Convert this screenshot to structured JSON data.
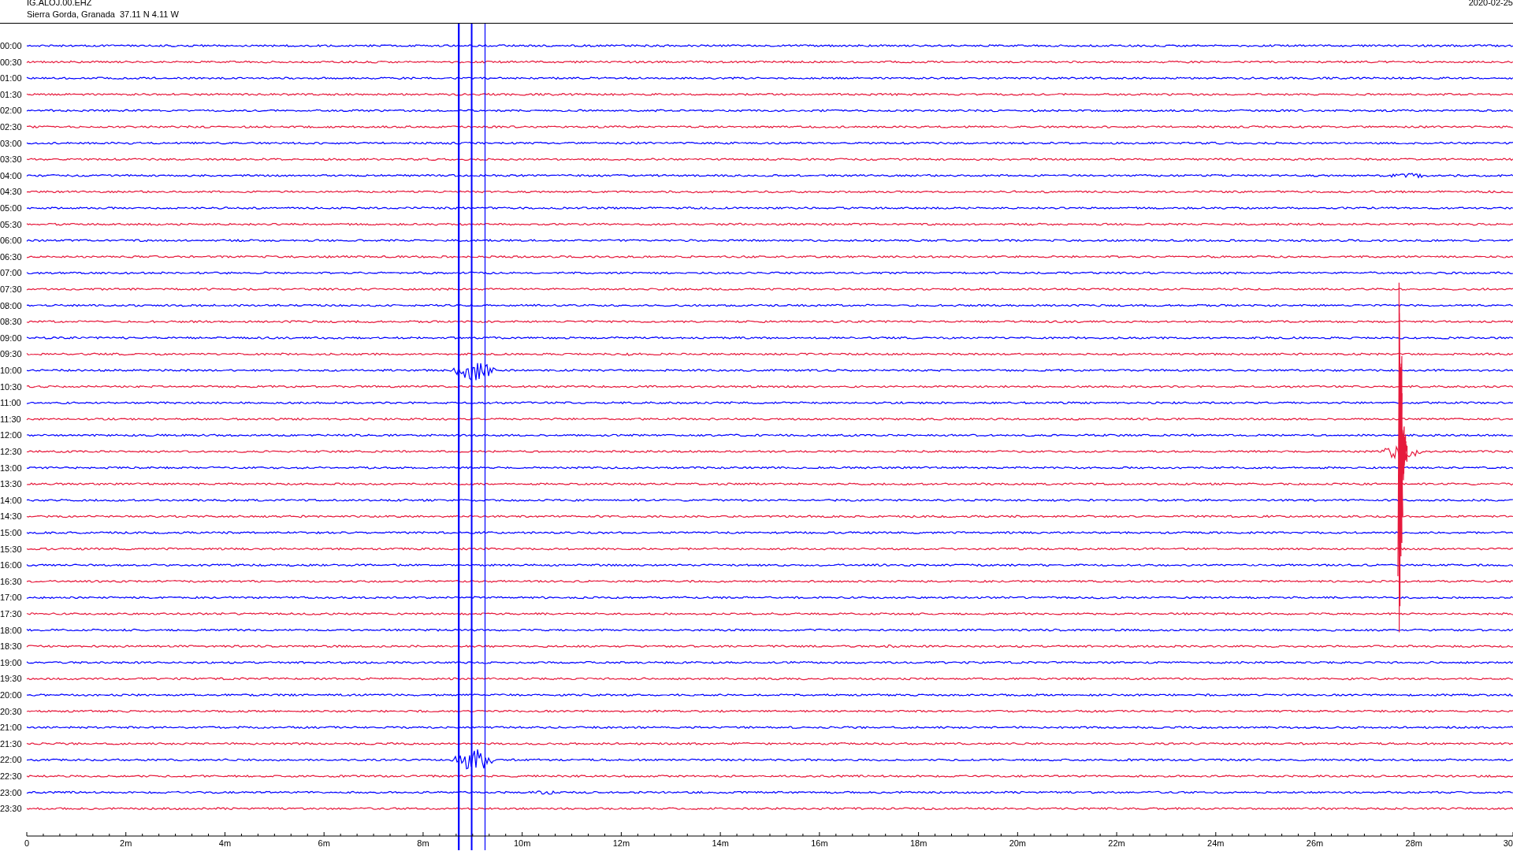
{
  "header": {
    "channel": "IG.ALOJ.00.EHZ",
    "location": "Sierra Gorda, Granada  37.11 N 4.11 W",
    "date": "2020-02-25"
  },
  "rows": [
    {
      "time": "00:00",
      "color": "#0000ff"
    },
    {
      "time": "00:30",
      "color": "#e6193c"
    },
    {
      "time": "01:00",
      "color": "#0000ff"
    },
    {
      "time": "01:30",
      "color": "#e6193c"
    },
    {
      "time": "02:00",
      "color": "#0000ff"
    },
    {
      "time": "02:30",
      "color": "#e6193c"
    },
    {
      "time": "03:00",
      "color": "#0000ff"
    },
    {
      "time": "03:30",
      "color": "#e6193c"
    },
    {
      "time": "04:00",
      "color": "#0000ff"
    },
    {
      "time": "04:30",
      "color": "#e6193c"
    },
    {
      "time": "05:00",
      "color": "#0000ff"
    },
    {
      "time": "05:30",
      "color": "#e6193c"
    },
    {
      "time": "06:00",
      "color": "#0000ff"
    },
    {
      "time": "06:30",
      "color": "#e6193c"
    },
    {
      "time": "07:00",
      "color": "#0000ff"
    },
    {
      "time": "07:30",
      "color": "#e6193c"
    },
    {
      "time": "08:00",
      "color": "#0000ff"
    },
    {
      "time": "08:30",
      "color": "#e6193c"
    },
    {
      "time": "09:00",
      "color": "#0000ff"
    },
    {
      "time": "09:30",
      "color": "#e6193c"
    },
    {
      "time": "10:00",
      "color": "#0000ff"
    },
    {
      "time": "10:30",
      "color": "#e6193c"
    },
    {
      "time": "11:00",
      "color": "#0000ff"
    },
    {
      "time": "11:30",
      "color": "#e6193c"
    },
    {
      "time": "12:00",
      "color": "#0000ff"
    },
    {
      "time": "12:30",
      "color": "#e6193c"
    },
    {
      "time": "13:00",
      "color": "#0000ff"
    },
    {
      "time": "13:30",
      "color": "#e6193c"
    },
    {
      "time": "14:00",
      "color": "#0000ff"
    },
    {
      "time": "14:30",
      "color": "#e6193c"
    },
    {
      "time": "15:00",
      "color": "#0000ff"
    },
    {
      "time": "15:30",
      "color": "#e6193c"
    },
    {
      "time": "16:00",
      "color": "#0000ff"
    },
    {
      "time": "16:30",
      "color": "#e6193c"
    },
    {
      "time": "17:00",
      "color": "#0000ff"
    },
    {
      "time": "17:30",
      "color": "#e6193c"
    },
    {
      "time": "18:00",
      "color": "#0000ff"
    },
    {
      "time": "18:30",
      "color": "#e6193c"
    },
    {
      "time": "19:00",
      "color": "#0000ff"
    },
    {
      "time": "19:30",
      "color": "#e6193c"
    },
    {
      "time": "20:00",
      "color": "#0000ff"
    },
    {
      "time": "20:30",
      "color": "#e6193c"
    },
    {
      "time": "21:00",
      "color": "#0000ff"
    },
    {
      "time": "21:30",
      "color": "#e6193c"
    },
    {
      "time": "22:00",
      "color": "#0000ff"
    },
    {
      "time": "22:30",
      "color": "#e6193c"
    },
    {
      "time": "23:00",
      "color": "#0000ff"
    },
    {
      "time": "23:30",
      "color": "#e6193c"
    }
  ],
  "x_axis": {
    "labels": [
      "0",
      "2m",
      "4m",
      "6m",
      "8m",
      "10m",
      "12m",
      "14m",
      "16m",
      "18m",
      "20m",
      "22m",
      "24m",
      "26m",
      "28m",
      "30"
    ]
  }
}
